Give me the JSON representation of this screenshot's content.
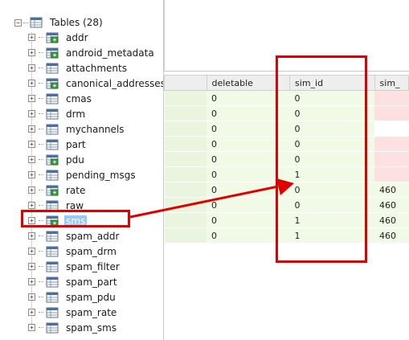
{
  "tree": {
    "root_label": "Tables (28)",
    "root_expander": "−",
    "item_expander": "+",
    "items": [
      {
        "label": "addr",
        "icon": "table-link-icon"
      },
      {
        "label": "android_metadata",
        "icon": "table-link-icon"
      },
      {
        "label": "attachments",
        "icon": "table-icon"
      },
      {
        "label": "canonical_addresses",
        "icon": "table-link-icon"
      },
      {
        "label": "cmas",
        "icon": "table-icon"
      },
      {
        "label": "drm",
        "icon": "table-icon"
      },
      {
        "label": "mychannels",
        "icon": "table-icon"
      },
      {
        "label": "part",
        "icon": "table-icon"
      },
      {
        "label": "pdu",
        "icon": "table-link-icon"
      },
      {
        "label": "pending_msgs",
        "icon": "table-icon"
      },
      {
        "label": "rate",
        "icon": "table-link-icon"
      },
      {
        "label": "raw",
        "icon": "table-icon"
      },
      {
        "label": "sms",
        "icon": "table-link-icon",
        "selected": true
      },
      {
        "label": "spam_addr",
        "icon": "table-icon"
      },
      {
        "label": "spam_drm",
        "icon": "table-icon"
      },
      {
        "label": "spam_filter",
        "icon": "table-icon"
      },
      {
        "label": "spam_part",
        "icon": "table-icon"
      },
      {
        "label": "spam_pdu",
        "icon": "table-icon"
      },
      {
        "label": "spam_rate",
        "icon": "table-icon"
      },
      {
        "label": "spam_sms",
        "icon": "table-icon"
      }
    ]
  },
  "grid": {
    "columns": [
      "",
      "deletable",
      "sim_id",
      "sim_"
    ],
    "rows": [
      [
        "",
        "0",
        "0",
        ""
      ],
      [
        "",
        "0",
        "0",
        ""
      ],
      [
        "",
        "0",
        "0",
        ""
      ],
      [
        "",
        "0",
        "0",
        ""
      ],
      [
        "",
        "0",
        "0",
        ""
      ],
      [
        "",
        "0",
        "1",
        ""
      ],
      [
        "",
        "0",
        "0",
        "460"
      ],
      [
        "",
        "0",
        "0",
        "460"
      ],
      [
        "",
        "0",
        "1",
        "460"
      ],
      [
        "",
        "0",
        "1",
        "460"
      ]
    ],
    "last_col_cell_styles": [
      "red",
      "red",
      "white",
      "red",
      "red",
      "red",
      "green",
      "green",
      "green",
      "green"
    ]
  },
  "colors": {
    "highlight_red": "#e00000",
    "row_green": "#f1fae6",
    "selection_blue": "#99c9f7"
  }
}
